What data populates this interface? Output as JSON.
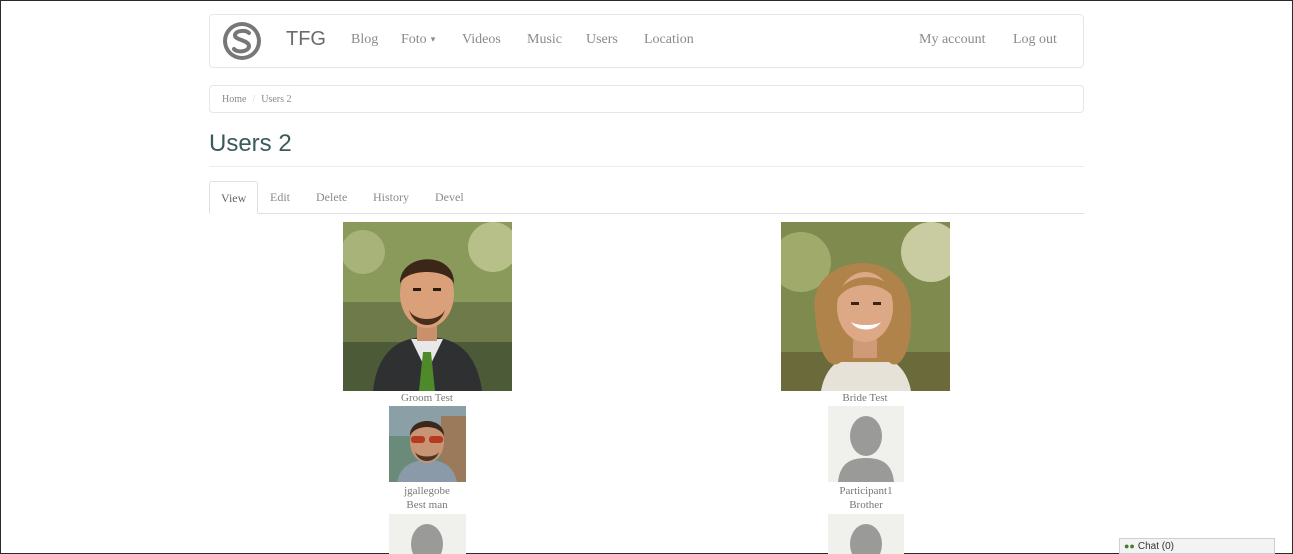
{
  "nav": {
    "brand": "TFG",
    "items": [
      {
        "label": "Blog"
      },
      {
        "label": "Foto"
      },
      {
        "label": "Videos"
      },
      {
        "label": "Music"
      },
      {
        "label": "Users"
      },
      {
        "label": "Location"
      }
    ],
    "right": [
      {
        "label": "My account"
      },
      {
        "label": "Log out"
      }
    ]
  },
  "breadcrumb": {
    "home": "Home",
    "sep": "/",
    "current": "Users 2"
  },
  "page": {
    "title": "Users 2"
  },
  "tabs": [
    {
      "label": "View"
    },
    {
      "label": "Edit"
    },
    {
      "label": "Delete"
    },
    {
      "label": "History"
    },
    {
      "label": "Devel"
    }
  ],
  "users": {
    "groom": {
      "name": "Groom Test"
    },
    "bride": {
      "name": "Bride Test"
    },
    "bestman": {
      "name": "jgallegobe",
      "role": "Best man"
    },
    "participant": {
      "name": "Participant1",
      "role": "Brother"
    }
  },
  "chat": {
    "label": "Chat (0)"
  }
}
